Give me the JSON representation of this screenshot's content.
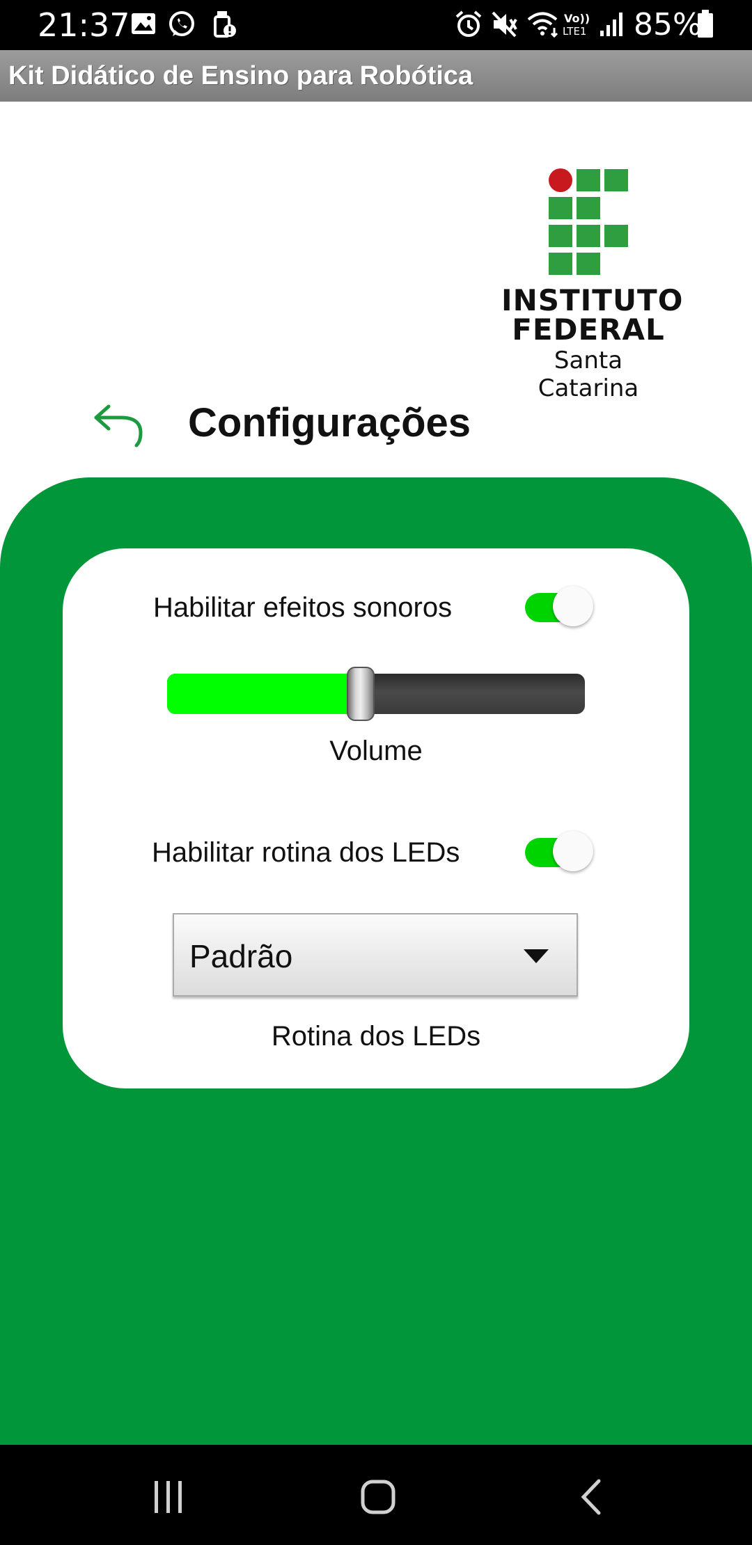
{
  "status_bar": {
    "time": "21:37",
    "battery_percent": "85%",
    "icons": [
      "image-icon",
      "whatsapp-icon",
      "usb-alert-icon",
      "alarm-icon",
      "mute-icon",
      "wifi-icon",
      "volte-icon",
      "signal-icon",
      "battery-icon"
    ],
    "network_label": "Vo)) LTE1"
  },
  "app_bar": {
    "title": "Kit Didático de Ensino para Robótica"
  },
  "logo": {
    "line1": "INSTITUTO",
    "line2": "FEDERAL",
    "line3": "Santa Catarina",
    "colors": {
      "green": "#2f9e41",
      "red": "#c8191e"
    }
  },
  "header": {
    "title": "Configurações",
    "back_icon": "undo-arrow-icon"
  },
  "settings": {
    "sound_effects": {
      "label": "Habilitar efeitos sonoros",
      "enabled": true
    },
    "volume": {
      "label": "Volume",
      "level": 0.45
    },
    "led_routine": {
      "label": "Habilitar rotina dos LEDs",
      "enabled": true
    },
    "led_routine_select": {
      "value": "Padrão",
      "caption": "Rotina dos LEDs"
    }
  },
  "colors": {
    "panel_green": "#02963a",
    "toggle_on": "#00d400",
    "slider_fill": "#00ff00",
    "accent_green": "#1e9a3e"
  },
  "nav_bar": {
    "buttons": [
      "recent-apps-icon",
      "home-icon",
      "back-icon"
    ]
  }
}
